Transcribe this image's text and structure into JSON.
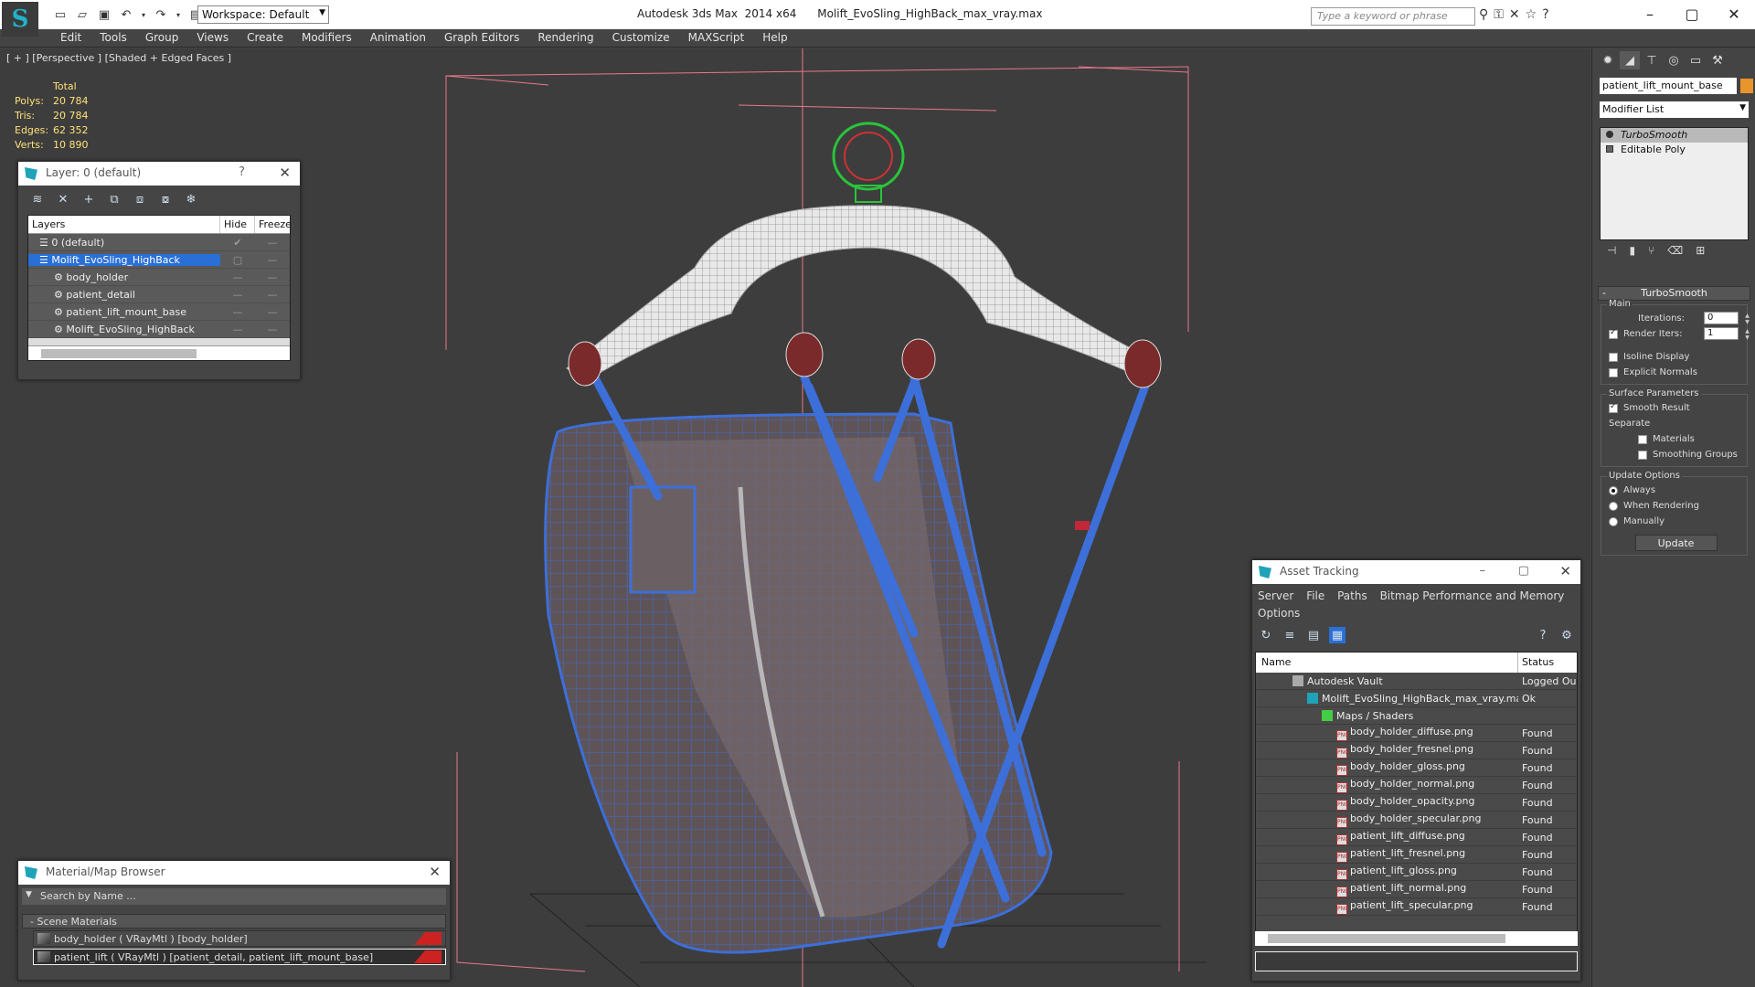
{
  "titlebar": {
    "app_title": "Autodesk 3ds Max  2014 x64      Molift_EvoSling_HighBack_max_vray.max",
    "workspace": "Workspace: Default",
    "search_placeholder": "Type a keyword or phrase"
  },
  "menu": [
    "Edit",
    "Tools",
    "Group",
    "Views",
    "Create",
    "Modifiers",
    "Animation",
    "Graph Editors",
    "Rendering",
    "Customize",
    "MAXScript",
    "Help"
  ],
  "viewport": {
    "label": "[ + ] [Perspective ] [Shaded + Edged Faces ]",
    "stats": {
      "header": "Total",
      "polys_label": "Polys:",
      "polys": "20 784",
      "tris_label": "Tris:",
      "tris": "20 784",
      "edges_label": "Edges:",
      "edges": "62 352",
      "verts_label": "Verts:",
      "verts": "10 890"
    }
  },
  "layer_window": {
    "title": "Layer: 0 (default)",
    "help": "?",
    "col_layers": "Layers",
    "col_hide": "Hide",
    "col_freeze": "Freeze",
    "rows": [
      {
        "name": "0 (default)"
      },
      {
        "name": "Molift_EvoSling_HighBack"
      },
      {
        "name": "body_holder"
      },
      {
        "name": "patient_detail"
      },
      {
        "name": "patient_lift_mount_base"
      },
      {
        "name": "Molift_EvoSling_HighBack"
      }
    ]
  },
  "material_browser": {
    "title": "Material/Map Browser",
    "search_placeholder": "Search by Name ...",
    "section": "- Scene Materials",
    "items": [
      "body_holder ( VRayMtl ) [body_holder]",
      "patient_lift ( VRayMtl ) [patient_detail, patient_lift_mount_base]"
    ]
  },
  "asset_tracking": {
    "title": "Asset Tracking",
    "menu": [
      "Server",
      "File",
      "Paths",
      "Bitmap Performance and Memory"
    ],
    "menu2": "Options",
    "col_name": "Name",
    "col_status": "Status",
    "rows": [
      {
        "name": "Autodesk Vault",
        "status": "Logged Ou"
      },
      {
        "name": "Molift_EvoSling_HighBack_max_vray.max",
        "status": "Ok"
      },
      {
        "name": "Maps / Shaders",
        "status": ""
      },
      {
        "name": "body_holder_diffuse.png",
        "status": "Found"
      },
      {
        "name": "body_holder_fresnel.png",
        "status": "Found"
      },
      {
        "name": "body_holder_gloss.png",
        "status": "Found"
      },
      {
        "name": "body_holder_normal.png",
        "status": "Found"
      },
      {
        "name": "body_holder_opacity.png",
        "status": "Found"
      },
      {
        "name": "body_holder_specular.png",
        "status": "Found"
      },
      {
        "name": "patient_lift_diffuse.png",
        "status": "Found"
      },
      {
        "name": "patient_lift_fresnel.png",
        "status": "Found"
      },
      {
        "name": "patient_lift_gloss.png",
        "status": "Found"
      },
      {
        "name": "patient_lift_normal.png",
        "status": "Found"
      },
      {
        "name": "patient_lift_specular.png",
        "status": "Found"
      }
    ]
  },
  "command_panel": {
    "object_name": "patient_lift_mount_base",
    "modifier_list": "Modifier List",
    "stack": [
      "TurboSmooth",
      "Editable Poly"
    ],
    "rollout": "TurboSmooth",
    "main_group": "Main",
    "iterations_label": "Iterations:",
    "iterations": "0",
    "render_iters_label": "Render Iters:",
    "render_iters": "1",
    "isoline": "Isoline Display",
    "explicit_normals": "Explicit Normals",
    "surface_group": "Surface Parameters",
    "smooth_result": "Smooth Result",
    "separate": "Separate",
    "materials": "Materials",
    "smoothing_groups": "Smoothing Groups",
    "update_group": "Update Options",
    "always": "Always",
    "when_rendering": "When Rendering",
    "manually": "Manually",
    "update_btn": "Update"
  }
}
